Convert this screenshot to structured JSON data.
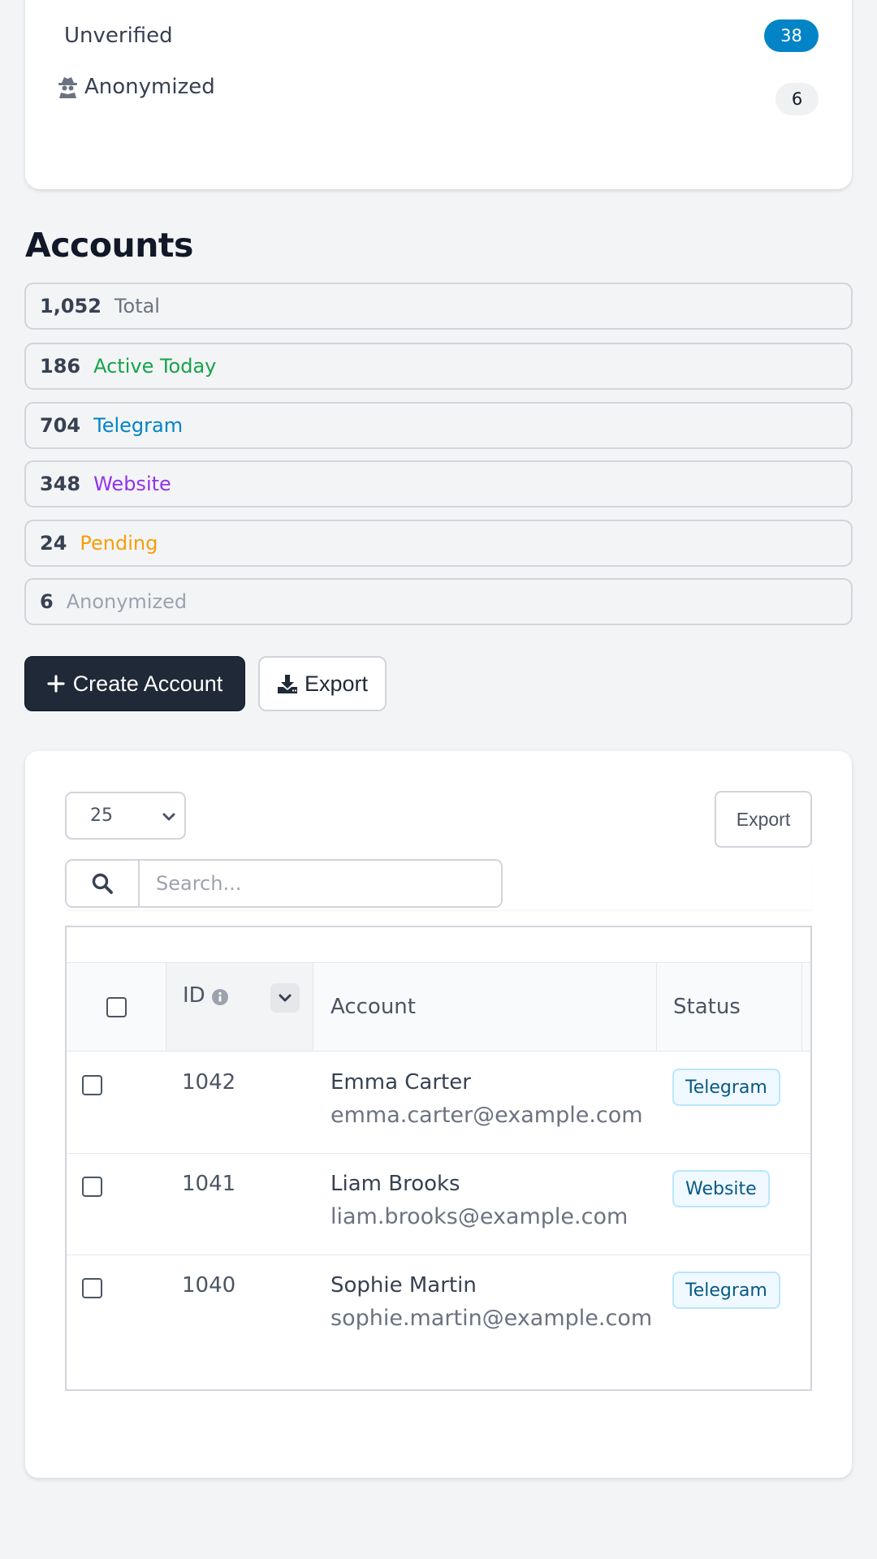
{
  "summary": {
    "unverified_label": "Unverified",
    "unverified_count": "38",
    "anonymized_label": "Anonymized",
    "anonymized_count": "6"
  },
  "accounts": {
    "title": "Accounts",
    "stats": [
      {
        "value": "1,052",
        "label": "Total",
        "color": "#6b7280"
      },
      {
        "value": "186",
        "label": "Active Today",
        "color": "#16a34a"
      },
      {
        "value": "704",
        "label": "Telegram",
        "color": "#0284c7"
      },
      {
        "value": "348",
        "label": "Website",
        "color": "#9333ea"
      },
      {
        "value": "24",
        "label": "Pending",
        "color": "#f59e0b"
      },
      {
        "value": "6",
        "label": "Anonymized",
        "color": "#9ca3af"
      }
    ],
    "create_label": "Create Account",
    "export_label": "Export"
  },
  "table": {
    "page_size": "25",
    "export_label": "Export",
    "search_placeholder": "Search...",
    "columns": {
      "id": "ID",
      "account": "Account",
      "status": "Status"
    },
    "rows": [
      {
        "id": "1042",
        "name": "Emma Carter",
        "email": "emma.carter@example.com",
        "status": "Telegram"
      },
      {
        "id": "1041",
        "name": "Liam Brooks",
        "email": "liam.brooks@example.com",
        "status": "Website"
      },
      {
        "id": "1040",
        "name": "Sophie Martin",
        "email": "sophie.martin@example.com",
        "status": "Telegram"
      }
    ]
  },
  "icons": {
    "anonymized": "spy-icon",
    "create": "plus-icon",
    "export": "download-icon",
    "search": "search-icon",
    "info": "info-icon",
    "sort": "chevron-down-icon",
    "select": "chevron-down-icon"
  }
}
